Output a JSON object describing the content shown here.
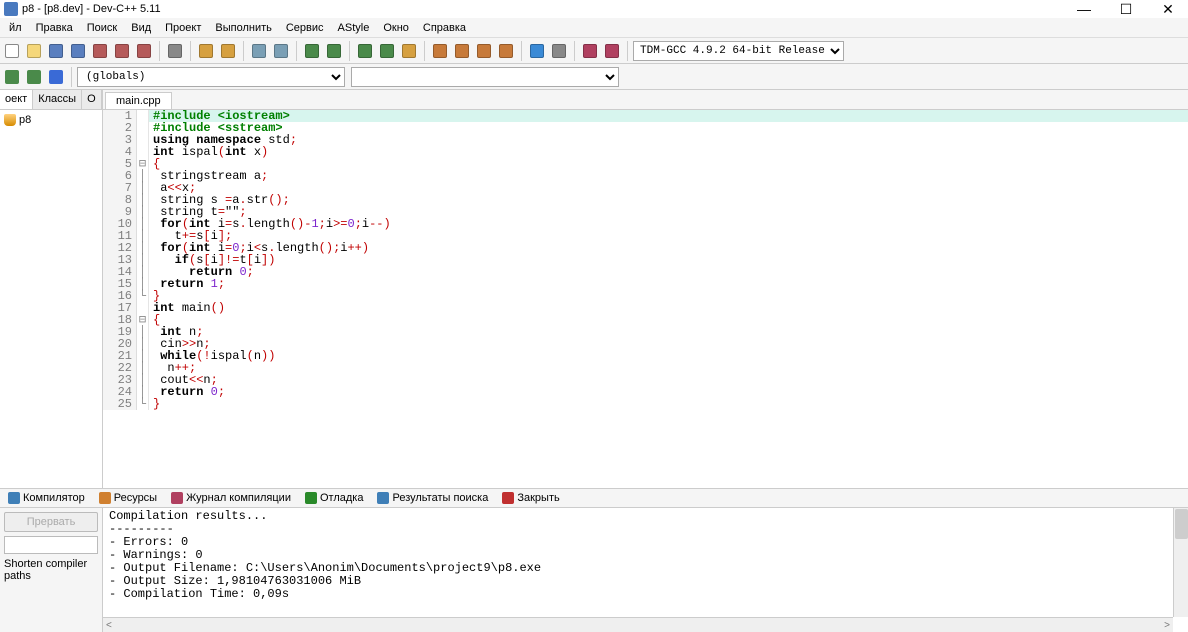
{
  "window": {
    "title": "p8 - [p8.dev] - Dev-C++ 5.11"
  },
  "menubar": [
    "йл",
    "Правка",
    "Поиск",
    "Вид",
    "Проект",
    "Выполнить",
    "Сервис",
    "AStyle",
    "Окно",
    "Справка"
  ],
  "compiler_dropdown": "TDM-GCC 4.9.2 64-bit Release",
  "scope_dropdown": "(globals)",
  "sidebar": {
    "tabs": [
      "оект",
      "Классы",
      "О"
    ],
    "nav": [
      "◂",
      "▸"
    ],
    "project": "p8"
  },
  "editor": {
    "tab": "main.cpp",
    "lines": [
      {
        "n": 1,
        "fold": "",
        "hl": true,
        "tokens": [
          {
            "c": "kw-green",
            "t": "#include <iostream>"
          }
        ]
      },
      {
        "n": 2,
        "fold": "",
        "tokens": [
          {
            "c": "kw-green",
            "t": "#include <sstream>"
          }
        ]
      },
      {
        "n": 3,
        "fold": "",
        "tokens": [
          {
            "c": "kw-bold",
            "t": "using namespace "
          },
          {
            "c": "",
            "t": "std"
          },
          {
            "c": "kw-red",
            "t": ";"
          }
        ]
      },
      {
        "n": 4,
        "fold": "",
        "tokens": [
          {
            "c": "kw-bold",
            "t": "int "
          },
          {
            "c": "",
            "t": "ispal"
          },
          {
            "c": "kw-red",
            "t": "("
          },
          {
            "c": "kw-bold",
            "t": "int "
          },
          {
            "c": "",
            "t": "x"
          },
          {
            "c": "kw-red",
            "t": ")"
          }
        ]
      },
      {
        "n": 5,
        "fold": "⊟",
        "tokens": [
          {
            "c": "kw-red",
            "t": "{"
          }
        ]
      },
      {
        "n": 6,
        "fold": "│",
        "tokens": [
          {
            "c": "",
            "t": " stringstream a"
          },
          {
            "c": "kw-red",
            "t": ";"
          }
        ]
      },
      {
        "n": 7,
        "fold": "│",
        "tokens": [
          {
            "c": "",
            "t": " a"
          },
          {
            "c": "kw-red",
            "t": "<<"
          },
          {
            "c": "",
            "t": "x"
          },
          {
            "c": "kw-red",
            "t": ";"
          }
        ]
      },
      {
        "n": 8,
        "fold": "│",
        "tokens": [
          {
            "c": "",
            "t": " string s "
          },
          {
            "c": "kw-red",
            "t": "="
          },
          {
            "c": "",
            "t": "a"
          },
          {
            "c": "kw-red",
            "t": "."
          },
          {
            "c": "",
            "t": "str"
          },
          {
            "c": "kw-red",
            "t": "();"
          }
        ]
      },
      {
        "n": 9,
        "fold": "│",
        "tokens": [
          {
            "c": "",
            "t": " string t"
          },
          {
            "c": "kw-red",
            "t": "="
          },
          {
            "c": "",
            "t": "\"\""
          },
          {
            "c": "kw-red",
            "t": ";"
          }
        ]
      },
      {
        "n": 10,
        "fold": "│",
        "tokens": [
          {
            "c": "",
            "t": " "
          },
          {
            "c": "kw-bold",
            "t": "for"
          },
          {
            "c": "kw-red",
            "t": "("
          },
          {
            "c": "kw-bold",
            "t": "int "
          },
          {
            "c": "",
            "t": "i"
          },
          {
            "c": "kw-red",
            "t": "="
          },
          {
            "c": "",
            "t": "s"
          },
          {
            "c": "kw-red",
            "t": "."
          },
          {
            "c": "",
            "t": "length"
          },
          {
            "c": "kw-red",
            "t": "()-"
          },
          {
            "c": "kw-purple",
            "t": "1"
          },
          {
            "c": "kw-red",
            "t": ";"
          },
          {
            "c": "",
            "t": "i"
          },
          {
            "c": "kw-red",
            "t": ">="
          },
          {
            "c": "kw-purple",
            "t": "0"
          },
          {
            "c": "kw-red",
            "t": ";"
          },
          {
            "c": "",
            "t": "i"
          },
          {
            "c": "kw-red",
            "t": "--)"
          }
        ]
      },
      {
        "n": 11,
        "fold": "│",
        "tokens": [
          {
            "c": "",
            "t": "   t"
          },
          {
            "c": "kw-red",
            "t": "+="
          },
          {
            "c": "",
            "t": "s"
          },
          {
            "c": "kw-red",
            "t": "["
          },
          {
            "c": "",
            "t": "i"
          },
          {
            "c": "kw-red",
            "t": "];"
          }
        ]
      },
      {
        "n": 12,
        "fold": "│",
        "tokens": [
          {
            "c": "",
            "t": " "
          },
          {
            "c": "kw-bold",
            "t": "for"
          },
          {
            "c": "kw-red",
            "t": "("
          },
          {
            "c": "kw-bold",
            "t": "int "
          },
          {
            "c": "",
            "t": "i"
          },
          {
            "c": "kw-red",
            "t": "="
          },
          {
            "c": "kw-purple",
            "t": "0"
          },
          {
            "c": "kw-red",
            "t": ";"
          },
          {
            "c": "",
            "t": "i"
          },
          {
            "c": "kw-red",
            "t": "<"
          },
          {
            "c": "",
            "t": "s"
          },
          {
            "c": "kw-red",
            "t": "."
          },
          {
            "c": "",
            "t": "length"
          },
          {
            "c": "kw-red",
            "t": "();"
          },
          {
            "c": "",
            "t": "i"
          },
          {
            "c": "kw-red",
            "t": "++)"
          }
        ]
      },
      {
        "n": 13,
        "fold": "│",
        "tokens": [
          {
            "c": "",
            "t": "   "
          },
          {
            "c": "kw-bold",
            "t": "if"
          },
          {
            "c": "kw-red",
            "t": "("
          },
          {
            "c": "",
            "t": "s"
          },
          {
            "c": "kw-red",
            "t": "["
          },
          {
            "c": "",
            "t": "i"
          },
          {
            "c": "kw-red",
            "t": "]!="
          },
          {
            "c": "",
            "t": "t"
          },
          {
            "c": "kw-red",
            "t": "["
          },
          {
            "c": "",
            "t": "i"
          },
          {
            "c": "kw-red",
            "t": "])"
          }
        ]
      },
      {
        "n": 14,
        "fold": "│",
        "tokens": [
          {
            "c": "",
            "t": "     "
          },
          {
            "c": "kw-bold",
            "t": "return "
          },
          {
            "c": "kw-purple",
            "t": "0"
          },
          {
            "c": "kw-red",
            "t": ";"
          }
        ]
      },
      {
        "n": 15,
        "fold": "│",
        "tokens": [
          {
            "c": "",
            "t": " "
          },
          {
            "c": "kw-bold",
            "t": "return "
          },
          {
            "c": "kw-purple",
            "t": "1"
          },
          {
            "c": "kw-red",
            "t": ";"
          }
        ]
      },
      {
        "n": 16,
        "fold": "└",
        "tokens": [
          {
            "c": "kw-red",
            "t": "}"
          }
        ]
      },
      {
        "n": 17,
        "fold": "",
        "tokens": [
          {
            "c": "kw-bold",
            "t": "int "
          },
          {
            "c": "",
            "t": "main"
          },
          {
            "c": "kw-red",
            "t": "()"
          }
        ]
      },
      {
        "n": 18,
        "fold": "⊟",
        "tokens": [
          {
            "c": "kw-red",
            "t": "{"
          }
        ]
      },
      {
        "n": 19,
        "fold": "│",
        "tokens": [
          {
            "c": "",
            "t": " "
          },
          {
            "c": "kw-bold",
            "t": "int "
          },
          {
            "c": "",
            "t": "n"
          },
          {
            "c": "kw-red",
            "t": ";"
          }
        ]
      },
      {
        "n": 20,
        "fold": "│",
        "tokens": [
          {
            "c": "",
            "t": " cin"
          },
          {
            "c": "kw-red",
            "t": ">>"
          },
          {
            "c": "",
            "t": "n"
          },
          {
            "c": "kw-red",
            "t": ";"
          }
        ]
      },
      {
        "n": 21,
        "fold": "│",
        "tokens": [
          {
            "c": "",
            "t": " "
          },
          {
            "c": "kw-bold",
            "t": "while"
          },
          {
            "c": "kw-red",
            "t": "(!"
          },
          {
            "c": "",
            "t": "ispal"
          },
          {
            "c": "kw-red",
            "t": "("
          },
          {
            "c": "",
            "t": "n"
          },
          {
            "c": "kw-red",
            "t": "))"
          }
        ]
      },
      {
        "n": 22,
        "fold": "│",
        "tokens": [
          {
            "c": "",
            "t": "  n"
          },
          {
            "c": "kw-red",
            "t": "++;"
          }
        ]
      },
      {
        "n": 23,
        "fold": "│",
        "tokens": [
          {
            "c": "",
            "t": " cout"
          },
          {
            "c": "kw-red",
            "t": "<<"
          },
          {
            "c": "",
            "t": "n"
          },
          {
            "c": "kw-red",
            "t": ";"
          }
        ]
      },
      {
        "n": 24,
        "fold": "│",
        "tokens": [
          {
            "c": "",
            "t": " "
          },
          {
            "c": "kw-bold",
            "t": "return "
          },
          {
            "c": "kw-purple",
            "t": "0"
          },
          {
            "c": "kw-red",
            "t": ";"
          }
        ]
      },
      {
        "n": 25,
        "fold": "└",
        "tokens": [
          {
            "c": "kw-red",
            "t": "}"
          }
        ]
      }
    ]
  },
  "bottomtabs": [
    {
      "icon": "#3f7fb7",
      "label": "Компилятор"
    },
    {
      "icon": "#d08030",
      "label": "Ресурсы"
    },
    {
      "icon": "#b04060",
      "label": "Журнал компиляции"
    },
    {
      "icon": "#2a8a2a",
      "label": "Отладка"
    },
    {
      "icon": "#3f7fb7",
      "label": "Результаты поиска"
    },
    {
      "icon": "#c03030",
      "label": "Закрыть"
    }
  ],
  "output_left": {
    "button": "Прервать",
    "short": "Shorten compiler paths"
  },
  "output": "Compilation results...\n---------\n- Errors: 0\n- Warnings: 0\n- Output Filename: C:\\Users\\Anonim\\Documents\\project9\\p8.exe\n- Output Size: 1,98104763031006 MiB\n- Compilation Time: 0,09s",
  "toolbar_icons": [
    {
      "name": "new-icon",
      "c": "#fff",
      "b": "#888"
    },
    {
      "name": "open-icon",
      "c": "#f5d77a"
    },
    {
      "name": "save-icon",
      "c": "#5a7fbf"
    },
    {
      "name": "save-all-icon",
      "c": "#5a7fbf"
    },
    {
      "name": "save-as-icon",
      "c": "#b55a5a"
    },
    {
      "name": "close-icon",
      "c": "#b55a5a"
    },
    {
      "name": "close-all-icon",
      "c": "#b55a5a"
    },
    {
      "sep": true
    },
    {
      "name": "print-icon",
      "c": "#888"
    },
    {
      "sep": true
    },
    {
      "name": "undo-icon",
      "c": "#d6a040"
    },
    {
      "name": "redo-icon",
      "c": "#d6a040"
    },
    {
      "sep": true
    },
    {
      "name": "find-icon",
      "c": "#7a9fb5"
    },
    {
      "name": "replace-icon",
      "c": "#7a9fb5"
    },
    {
      "sep": true
    },
    {
      "name": "bookmark-icon",
      "c": "#4a8a4a"
    },
    {
      "name": "bookmark-next-icon",
      "c": "#4a8a4a"
    },
    {
      "sep": true
    },
    {
      "name": "goto-icon",
      "c": "#4a8a4a"
    },
    {
      "name": "goto2-icon",
      "c": "#4a8a4a"
    },
    {
      "name": "debug-shield-icon",
      "c": "#d6a040"
    },
    {
      "sep": true
    },
    {
      "name": "grid1-icon",
      "c": "#c77a3a"
    },
    {
      "name": "grid2-icon",
      "c": "#c77a3a"
    },
    {
      "name": "grid3-icon",
      "c": "#c77a3a"
    },
    {
      "name": "grid4-icon",
      "c": "#c77a3a"
    },
    {
      "sep": true
    },
    {
      "name": "check-icon",
      "c": "#3a8ad6"
    },
    {
      "name": "x-icon",
      "c": "#888"
    },
    {
      "sep": true
    },
    {
      "name": "chart1-icon",
      "c": "#b04060"
    },
    {
      "name": "chart2-icon",
      "c": "#b04060"
    }
  ],
  "toolbar2_icons": [
    {
      "name": "back-icon",
      "c": "#4a8a4a"
    },
    {
      "name": "forward-icon",
      "c": "#4a8a4a"
    },
    {
      "name": "bookmark-blue-icon",
      "c": "#3a6ad6"
    }
  ]
}
